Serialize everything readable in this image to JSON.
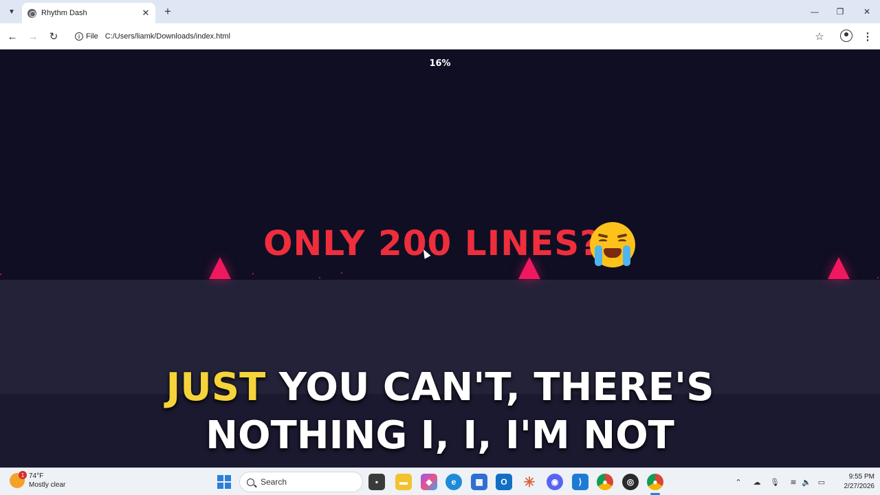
{
  "browser": {
    "tab_title": "Rhythm Dash",
    "new_tab_symbol": "+",
    "scheme_chip": "File",
    "url": "C:/Users/liamk/Downloads/index.html"
  },
  "game": {
    "progress_text": "16%",
    "progress": 0.16,
    "headline": "ONLY 200 LINES?! ",
    "headline_emoji": "loudly-crying-face",
    "spike_color": "#f0185f",
    "caption_highlight": "JUST",
    "caption_rest": " YOU CAN'T, THERE'S NOTHING I, I, I'M NOT",
    "colors": {
      "background": "#0f0e23",
      "ground": "#232239",
      "headline": "#ee2e3d",
      "caption_highlight": "#f5d33b"
    }
  },
  "taskbar": {
    "weather_badge": "1",
    "weather_temp": "74°F",
    "weather_desc": "Mostly clear",
    "search_label": "Search",
    "time": "9:55 PM",
    "date": "2/27/2026",
    "apps": [
      "file-manager",
      "explorer",
      "copilot",
      "edge",
      "store",
      "outlook",
      "claude",
      "discord",
      "vscode",
      "chrome",
      "obs",
      "chrome-active"
    ]
  }
}
